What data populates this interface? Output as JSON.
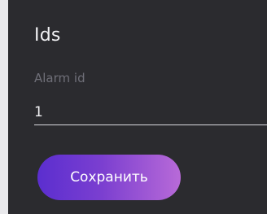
{
  "section": {
    "title": "Ids"
  },
  "alarm_id_field": {
    "label": "Alarm id",
    "value": "1"
  },
  "actions": {
    "save_label": "Сохранить"
  },
  "colors": {
    "panel_background": "#2b2b2f",
    "text_primary": "#f1f1f4",
    "text_muted": "#6f6f78",
    "button_gradient_start": "#5b2ecf",
    "button_gradient_end": "#b86ad8"
  }
}
